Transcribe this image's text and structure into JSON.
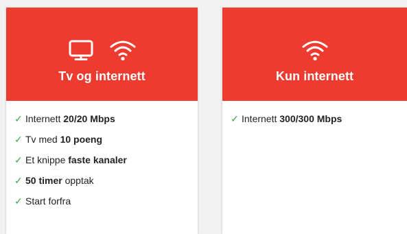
{
  "colors": {
    "header_red": "#ee3b2f",
    "check_green": "#3ea64a",
    "text": "#222222"
  },
  "icons": {
    "check": "✓",
    "tv": "tv-icon",
    "wifi": "wifi-icon"
  },
  "cards": [
    {
      "title": "Tv og internett",
      "features": [
        {
          "pre": "Internett ",
          "bold": "20/20 Mbps",
          "post": ""
        },
        {
          "pre": "Tv med ",
          "bold": "10 poeng",
          "post": ""
        },
        {
          "pre": "Et knippe ",
          "bold": "faste kanaler",
          "post": ""
        },
        {
          "pre": "",
          "bold": "50 timer",
          "post": " opptak"
        },
        {
          "pre": "Start forfra",
          "bold": "",
          "post": ""
        }
      ]
    },
    {
      "title": "Kun internett",
      "features": [
        {
          "pre": "Internett ",
          "bold": "300/300 Mbps",
          "post": ""
        }
      ]
    }
  ]
}
